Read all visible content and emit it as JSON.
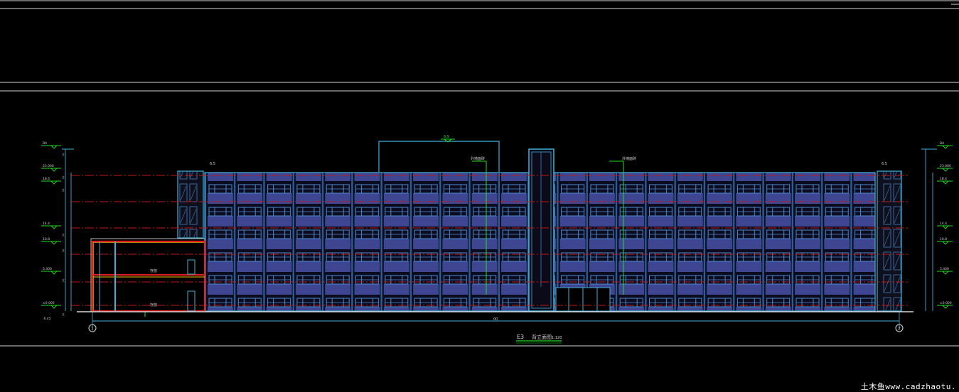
{
  "drawing": {
    "title_prefix": "E3",
    "title_main": "背立面图",
    "title_scale": "1:120",
    "top_dim_label": "6.9",
    "axis_left": "1",
    "axis_right": "2",
    "total_dim": "00",
    "grid_line": "1",
    "side_dim": "1",
    "bracket_left": "立",
    "bracket_right": "立",
    "room_upper": "存放",
    "room_lower": "存放",
    "levels_left": [
      {
        "label": "BA",
        "dim": "立"
      },
      {
        "label": "23.000",
        "dim": "立"
      },
      {
        "label": "18.4",
        "dim": "立"
      },
      {
        "label": "14.4",
        "dim": "立"
      },
      {
        "label": "10.8",
        "dim": "立"
      },
      {
        "label": "5.400",
        "dim": "立"
      },
      {
        "label": "±0.000",
        "dim": "立"
      }
    ],
    "levels_right": [
      {
        "label": "BA"
      },
      {
        "label": "23.000"
      },
      {
        "label": "18.4"
      },
      {
        "label": "14.4"
      },
      {
        "label": "10.8"
      },
      {
        "label": "5.400"
      },
      {
        "label": "±0.000"
      }
    ],
    "level_bottom": "-0.45",
    "callout_left": "外墙面砖",
    "callout_right": "外墙面砖",
    "roof_tag_left": "6.5",
    "roof_tag_right": "6.5"
  },
  "watermark": "土木鱼www.cadzhaotu."
}
